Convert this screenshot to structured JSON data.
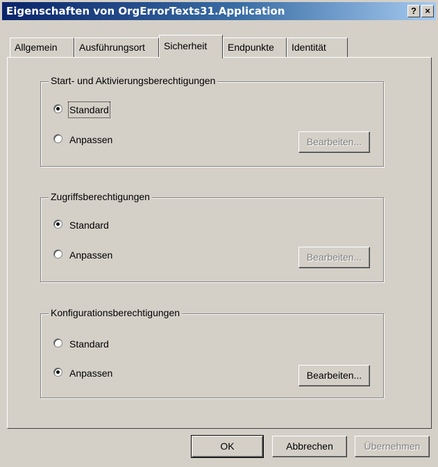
{
  "window": {
    "title": "Eigenschaften von OrgErrorTexts31.Application",
    "help_label": "?",
    "close_label": "×"
  },
  "tabs": [
    {
      "label": "Allgemein"
    },
    {
      "label": "Ausführungsort"
    },
    {
      "label": "Sicherheit",
      "active": true
    },
    {
      "label": "Endpunkte"
    },
    {
      "label": "Identität"
    }
  ],
  "groups": [
    {
      "title": "Start- und Aktivierungsberechtigungen",
      "option_standard": "Standard",
      "option_custom": "Anpassen",
      "selected": "standard",
      "edit_label": "Bearbeiten...",
      "edit_enabled": false
    },
    {
      "title": "Zugriffsberechtigungen",
      "option_standard": "Standard",
      "option_custom": "Anpassen",
      "selected": "standard",
      "edit_label": "Bearbeiten...",
      "edit_enabled": false
    },
    {
      "title": "Konfigurationsberechtigungen",
      "option_standard": "Standard",
      "option_custom": "Anpassen",
      "selected": "custom",
      "edit_label": "Bearbeiten...",
      "edit_enabled": true
    }
  ],
  "footer": {
    "ok_label": "OK",
    "cancel_label": "Abbrechen",
    "apply_label": "Übernehmen"
  }
}
